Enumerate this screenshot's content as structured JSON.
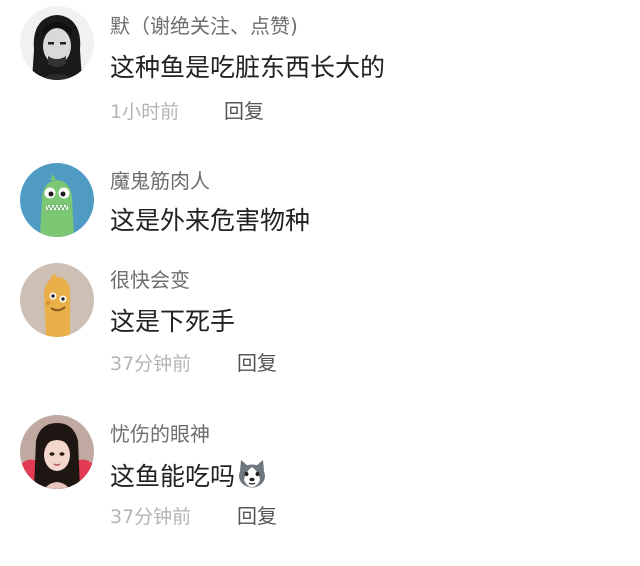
{
  "comments": [
    {
      "username": "默（谢绝关注、点赞)",
      "text": "这种鱼是吃脏东西长大的",
      "time": "1小时前",
      "reply": "回复",
      "avatar_icon": "man-portrait-avatar"
    },
    {
      "username": "魔鬼筋肉人",
      "text": "这是外来危害物种",
      "avatar_icon": "green-monster-avatar"
    },
    {
      "username": "很快会变",
      "text": "这是下死手",
      "time": "37分钟前",
      "reply": "回复",
      "avatar_icon": "cartoon-sausage-avatar"
    },
    {
      "username": "忧伤的眼神",
      "text": "这鱼能吃吗",
      "time": "37分钟前",
      "reply": "回复",
      "avatar_icon": "girl-photo-avatar",
      "trailing_emoji": "husky-dog-emoji-icon"
    }
  ],
  "colors": {
    "username": "#6e6e6e",
    "content": "#222222",
    "meta": "#b4b4b4",
    "reply": "#555555",
    "background": "#ffffff"
  }
}
